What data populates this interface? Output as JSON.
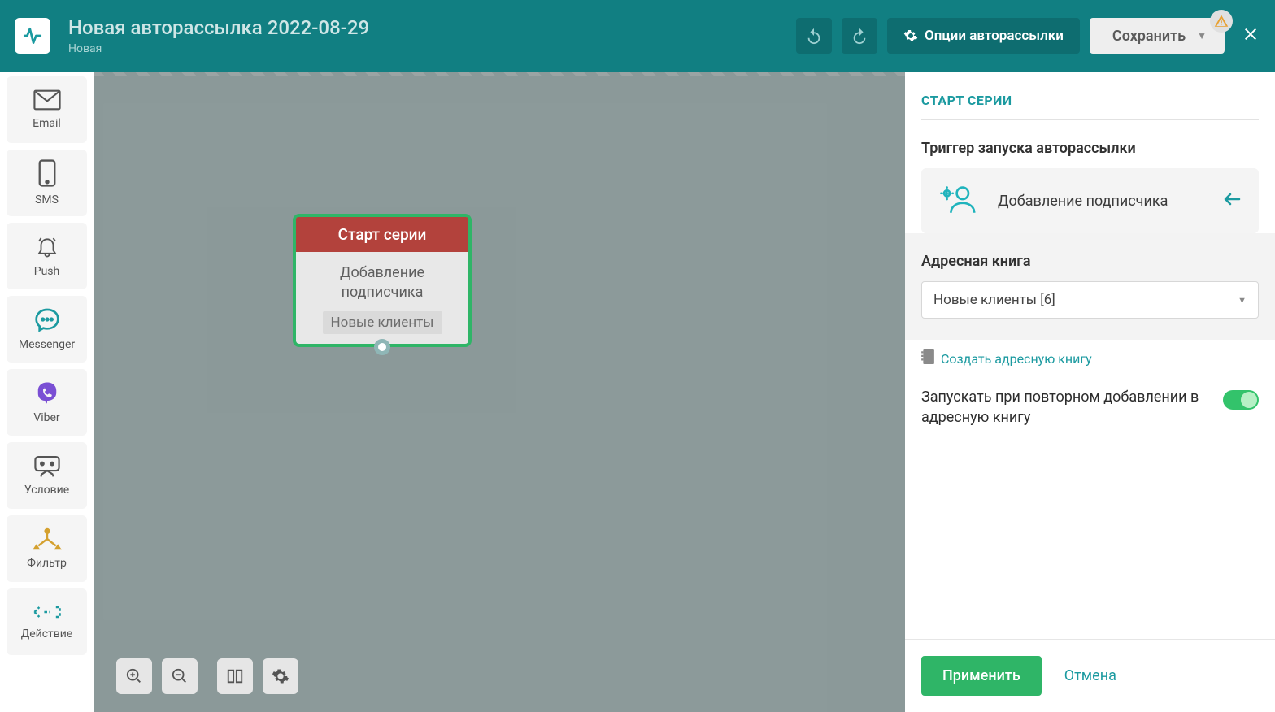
{
  "header": {
    "title": "Новая авторассылка 2022-08-29",
    "status": "Новая",
    "options_label": "Опции авторассылки",
    "save_label": "Сохранить"
  },
  "sidebar": {
    "items": [
      {
        "label": "Email"
      },
      {
        "label": "SMS"
      },
      {
        "label": "Push"
      },
      {
        "label": "Messenger"
      },
      {
        "label": "Viber"
      },
      {
        "label": "Условие"
      },
      {
        "label": "Фильтр"
      },
      {
        "label": "Действие"
      }
    ]
  },
  "canvas": {
    "node": {
      "header": "Старт серии",
      "body_line1": "Добавление",
      "body_line2": "подписчика",
      "tag": "Новые клиенты"
    }
  },
  "panel": {
    "heading": "СТАРТ СЕРИИ",
    "trigger_label": "Триггер запуска авторассылки",
    "trigger_value": "Добавление подписчика",
    "address_book_label": "Адресная книга",
    "address_book_value": "Новые клиенты [6]",
    "create_book_label": "Создать адресную книгу",
    "repeat_label": "Запускать при повторном добавлении в адресную книгу",
    "apply": "Применить",
    "cancel": "Отмена"
  }
}
